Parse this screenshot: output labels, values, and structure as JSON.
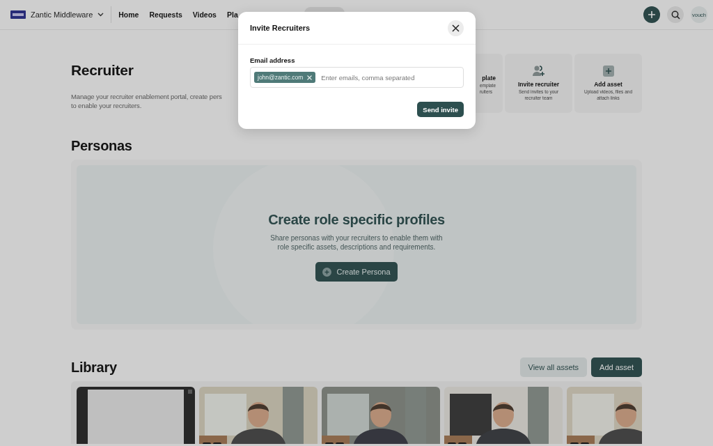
{
  "topbar": {
    "workspace": "Zantic Middleware",
    "nav": [
      {
        "label": "Home"
      },
      {
        "label": "Requests"
      },
      {
        "label": "Videos"
      },
      {
        "label": "Pla"
      }
    ],
    "avatar": "vouch"
  },
  "header": {
    "title": "Recruiter",
    "description_lines": [
      "Manage your recruiter enablement portal, create pers",
      "to enable your recruiters."
    ]
  },
  "quick_actions": [
    {
      "kind": "template",
      "title": "plate",
      "description_lines": [
        "emplate",
        "ruiters"
      ]
    },
    {
      "kind": "invite",
      "title": "Invite recruiter",
      "description_lines": [
        "Send invites to your",
        "recruiter team"
      ]
    },
    {
      "kind": "asset",
      "title": "Add asset",
      "description_lines": [
        "Upload videos, files and",
        "attach links"
      ]
    }
  ],
  "personas": {
    "title": "Personas",
    "empty_title": "Create role specific profiles",
    "empty_text": "Share personas with your recruiters to enable them with role specific assets, descriptions and requirements.",
    "button": "Create Persona"
  },
  "library": {
    "title": "Library",
    "buttons": [
      {
        "kind": "secondary",
        "label": "View all assets"
      },
      {
        "kind": "primary",
        "label": "Add asset"
      }
    ]
  },
  "modal": {
    "title": "Invite Recruiters",
    "field_label": "Email address",
    "chips": [
      "john@zantic.com"
    ],
    "placeholder": "Enter emails, comma separated",
    "submit": "Send invite"
  }
}
